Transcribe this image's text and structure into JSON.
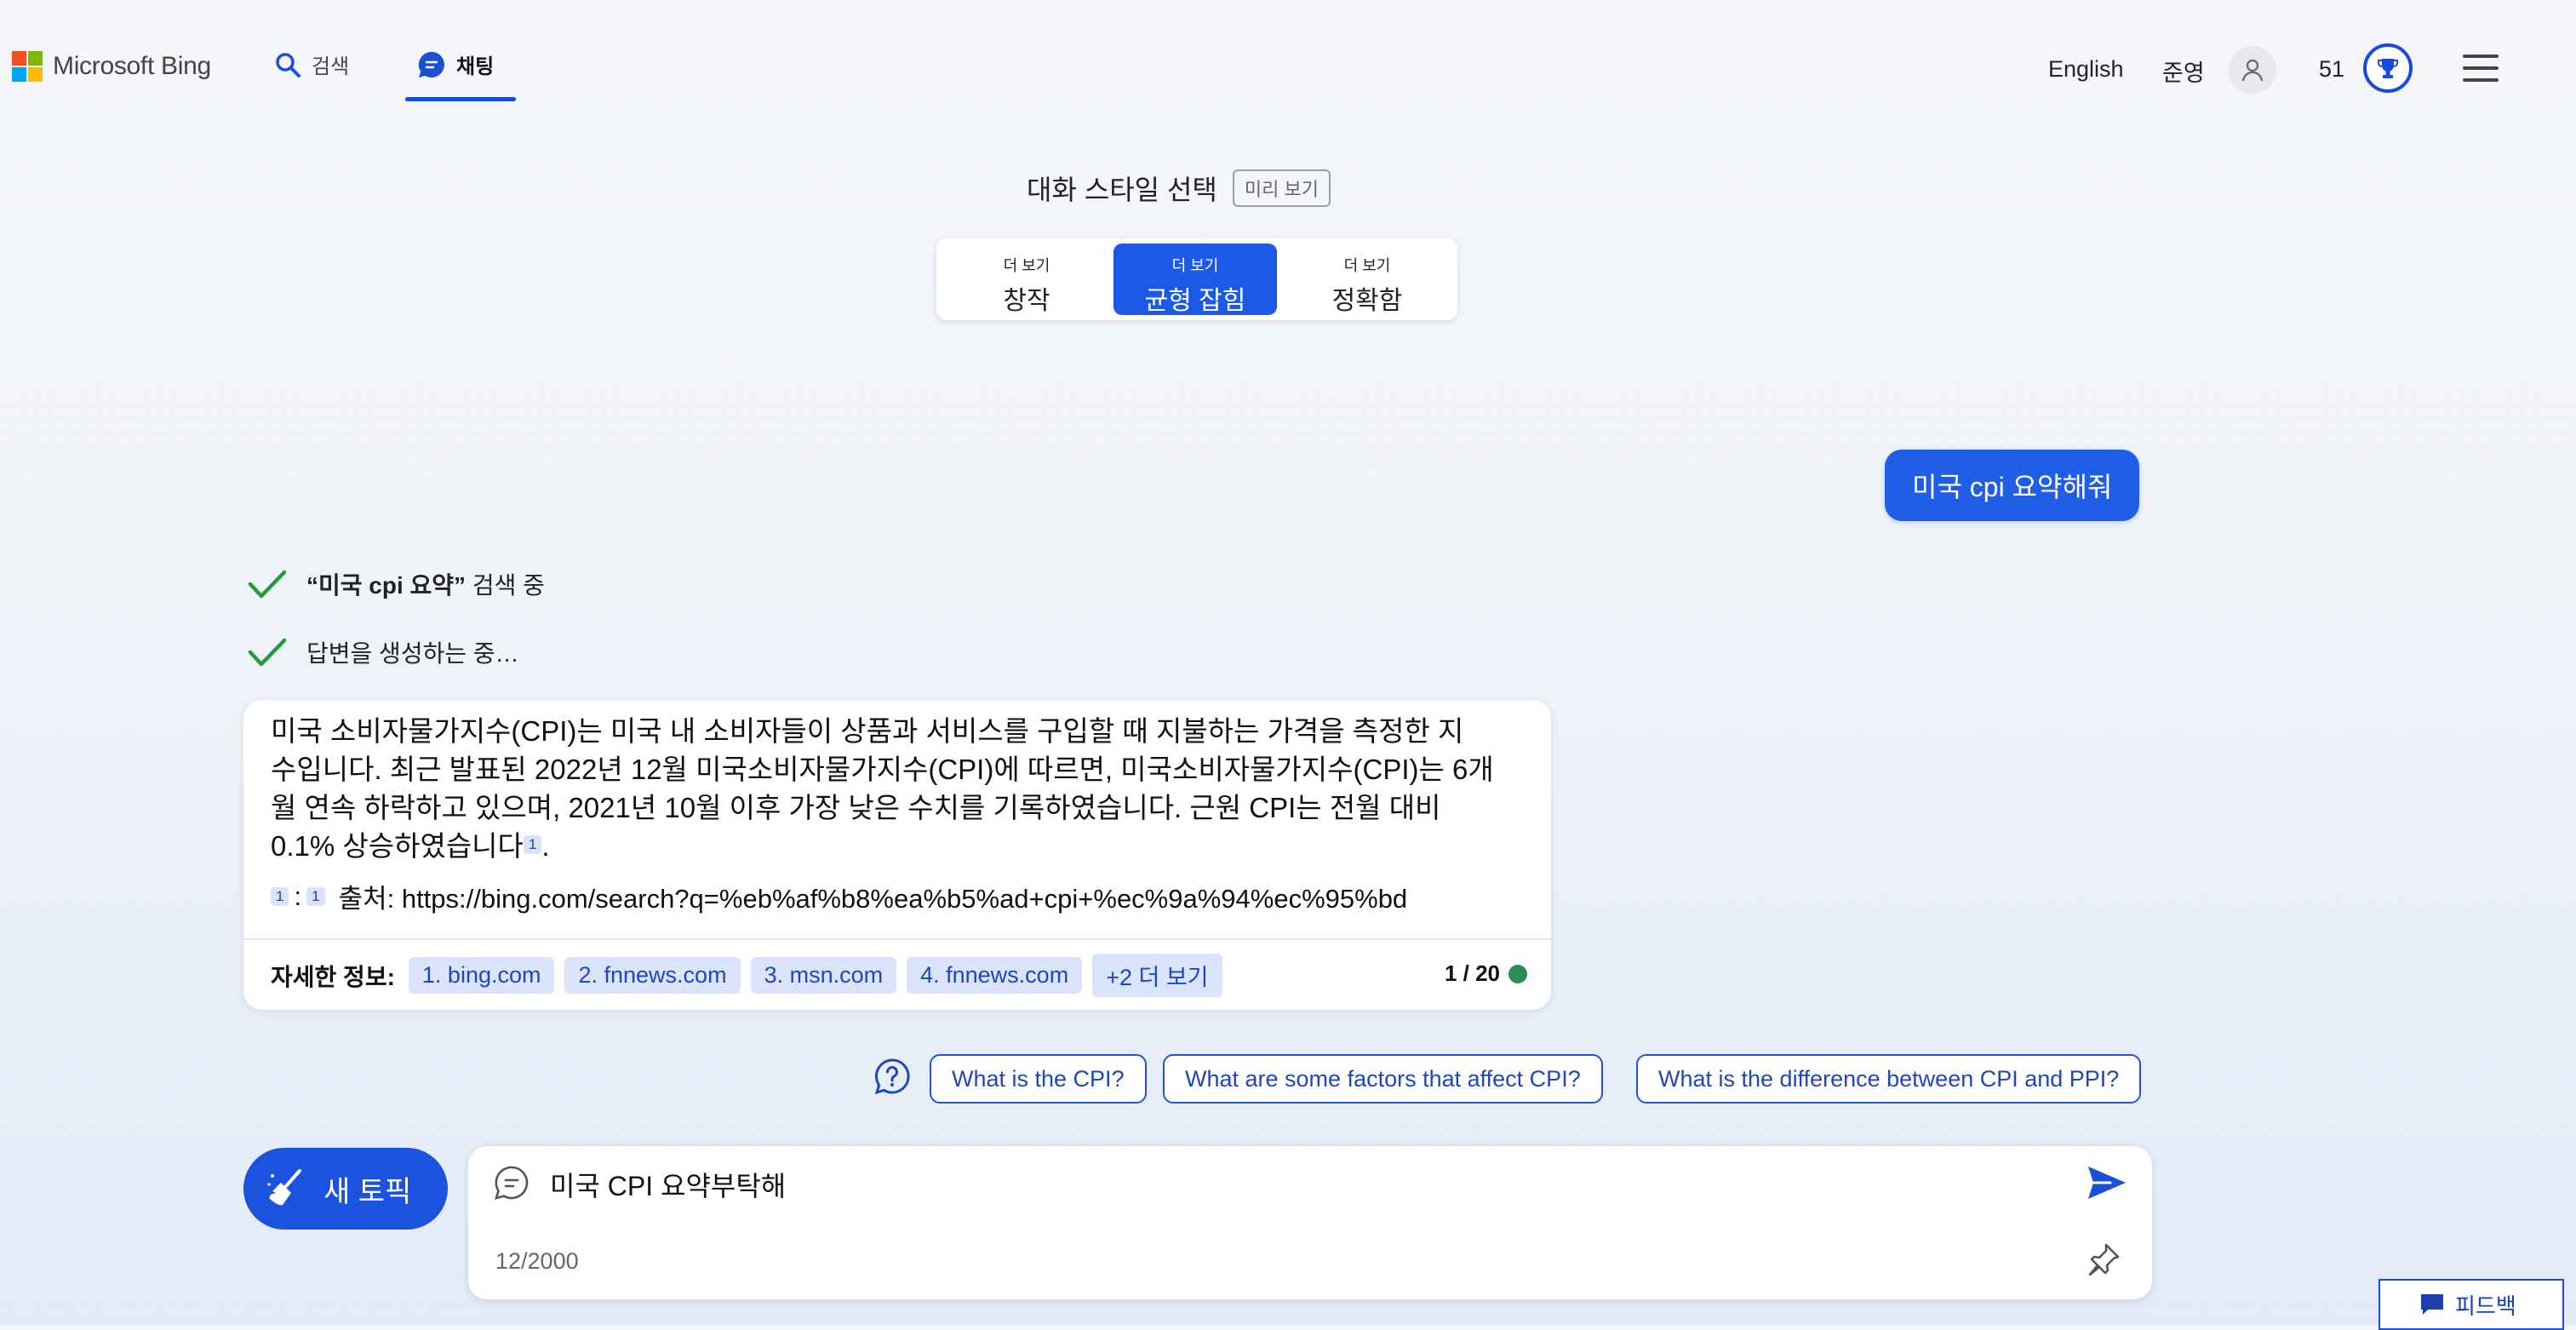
{
  "header": {
    "brand": "Microsoft Bing",
    "nav_search": "검색",
    "nav_chat": "채팅",
    "language": "English",
    "username": "준영",
    "reward_points": "51"
  },
  "style_selector": {
    "title": "대화 스타일 선택",
    "preview_badge": "미리 보기",
    "options": [
      {
        "small": "더 보기",
        "label": "창작"
      },
      {
        "small": "더 보기",
        "label": "균형 잡힘"
      },
      {
        "small": "더 보기",
        "label": "정확함"
      }
    ],
    "active_index": 1
  },
  "conversation": {
    "user_message": "미국 cpi 요약해줘",
    "progress": [
      {
        "bold": "“미국 cpi 요약”",
        "rest": " 검색 중"
      },
      {
        "bold": "",
        "rest": "답변을 생성하는 중…"
      }
    ],
    "answer": {
      "line1": "미국 소비자물가지수(CPI)는 미국 내 소비자들이 상품과 서비스를 구입할 때 지불하는 가격을 측정한 지",
      "line2": "수입니다. 최근 발표된 2022년 12월 미국소비자물가지수(CPI)에 따르면, 미국소비자물가지수(CPI)는 6개",
      "line3": "월 연속 하락하고 있으며, 2021년 10월 이후 가장 낮은 수치를 기록하였습니다. 근원 CPI는 전월 대비",
      "line4": "0.1% 상승하였습니다",
      "citation": "1",
      "period": ".",
      "source_ref_a": "1",
      "source_sep": ":",
      "source_ref_b": "1",
      "source_text": "출처: https://bing.com/search?q=%eb%af%b8%ea%b5%ad+cpi+%ec%9a%94%ec%95%bd"
    },
    "learn_more_label": "자세한 정보:",
    "links": [
      "1. bing.com",
      "2. fnnews.com",
      "3. msn.com",
      "4. fnnews.com",
      "+2 더 보기"
    ],
    "turn_counter": "1 / 20",
    "status_color": "#2e8b57"
  },
  "suggestions": [
    "What is the CPI?",
    "What are some factors that affect CPI?",
    "What is the difference between CPI and PPI?"
  ],
  "composer": {
    "new_topic_label": "새 토픽",
    "input_value": "미국 CPI 요약부탁해",
    "char_count": "12/2000"
  },
  "feedback_label": "피드백",
  "colors": {
    "accent": "#174ae4",
    "user_bubble": "#1f5fe8",
    "chip_bg": "#dbe4fb"
  }
}
